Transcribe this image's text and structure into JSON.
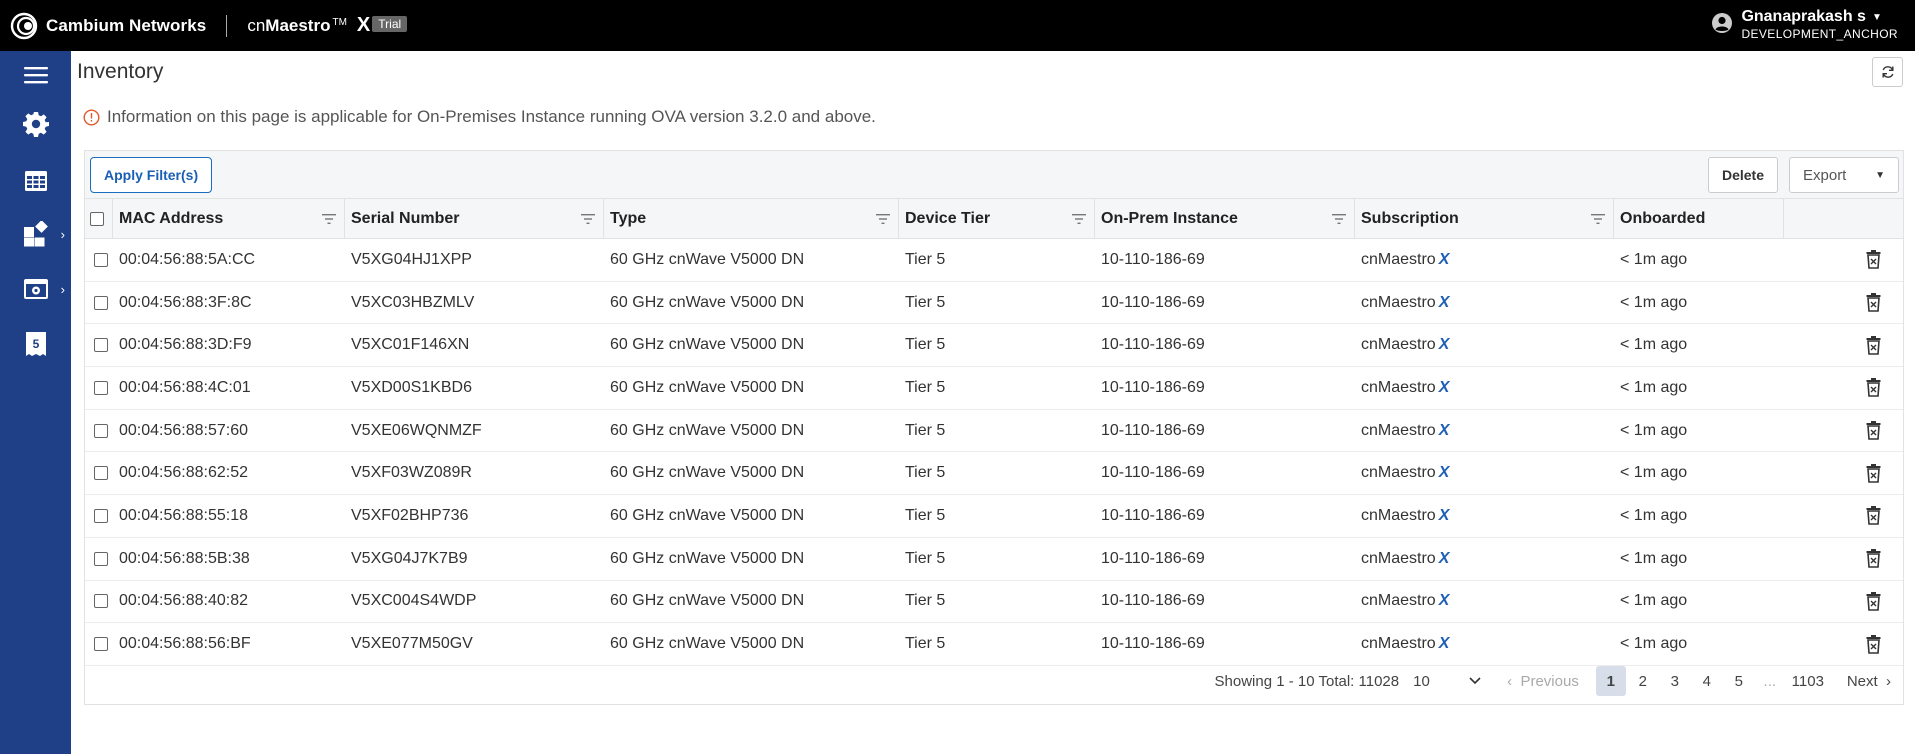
{
  "header": {
    "brand": "Cambium Networks",
    "product_prefix": "cn",
    "product_name": "Maestro",
    "product_tm": "TM",
    "product_x": "X",
    "trial_badge": "Trial",
    "user_name": "Gnanaprakash s",
    "user_org": "DEVELOPMENT_ANCHOR"
  },
  "sidebar": {
    "items": [
      {
        "icon": "menu-icon"
      },
      {
        "icon": "gear-icon"
      },
      {
        "icon": "table-icon"
      },
      {
        "icon": "dashboard-widgets-icon",
        "expandable": true
      },
      {
        "icon": "settings-window-icon",
        "expandable": true
      },
      {
        "icon": "license-tag-icon",
        "label": "5"
      }
    ]
  },
  "page": {
    "title": "Inventory",
    "info": "Information on this page is applicable for On-Premises Instance running OVA version 3.2.0 and above."
  },
  "toolbar": {
    "apply_filters": "Apply Filter(s)",
    "delete": "Delete",
    "export": "Export"
  },
  "table": {
    "columns": [
      "MAC Address",
      "Serial Number",
      "Type",
      "Device Tier",
      "On-Prem Instance",
      "Subscription",
      "Onboarded"
    ],
    "rows": [
      {
        "mac": "00:04:56:88:5A:CC",
        "serial": "V5XG04HJ1XPP",
        "type": "60 GHz cnWave V5000 DN",
        "tier": "Tier 5",
        "instance": "10-110-186-69",
        "subscription": "cnMaestro",
        "sub_suffix": "X",
        "onboarded": "< 1m ago"
      },
      {
        "mac": "00:04:56:88:3F:8C",
        "serial": "V5XC03HBZMLV",
        "type": "60 GHz cnWave V5000 DN",
        "tier": "Tier 5",
        "instance": "10-110-186-69",
        "subscription": "cnMaestro",
        "sub_suffix": "X",
        "onboarded": "< 1m ago"
      },
      {
        "mac": "00:04:56:88:3D:F9",
        "serial": "V5XC01F146XN",
        "type": "60 GHz cnWave V5000 DN",
        "tier": "Tier 5",
        "instance": "10-110-186-69",
        "subscription": "cnMaestro",
        "sub_suffix": "X",
        "onboarded": "< 1m ago"
      },
      {
        "mac": "00:04:56:88:4C:01",
        "serial": "V5XD00S1KBD6",
        "type": "60 GHz cnWave V5000 DN",
        "tier": "Tier 5",
        "instance": "10-110-186-69",
        "subscription": "cnMaestro",
        "sub_suffix": "X",
        "onboarded": "< 1m ago"
      },
      {
        "mac": "00:04:56:88:57:60",
        "serial": "V5XE06WQNMZF",
        "type": "60 GHz cnWave V5000 DN",
        "tier": "Tier 5",
        "instance": "10-110-186-69",
        "subscription": "cnMaestro",
        "sub_suffix": "X",
        "onboarded": "< 1m ago"
      },
      {
        "mac": "00:04:56:88:62:52",
        "serial": "V5XF03WZ089R",
        "type": "60 GHz cnWave V5000 DN",
        "tier": "Tier 5",
        "instance": "10-110-186-69",
        "subscription": "cnMaestro",
        "sub_suffix": "X",
        "onboarded": "< 1m ago"
      },
      {
        "mac": "00:04:56:88:55:18",
        "serial": "V5XF02BHP736",
        "type": "60 GHz cnWave V5000 DN",
        "tier": "Tier 5",
        "instance": "10-110-186-69",
        "subscription": "cnMaestro",
        "sub_suffix": "X",
        "onboarded": "< 1m ago"
      },
      {
        "mac": "00:04:56:88:5B:38",
        "serial": "V5XG04J7K7B9",
        "type": "60 GHz cnWave V5000 DN",
        "tier": "Tier 5",
        "instance": "10-110-186-69",
        "subscription": "cnMaestro",
        "sub_suffix": "X",
        "onboarded": "< 1m ago"
      },
      {
        "mac": "00:04:56:88:40:82",
        "serial": "V5XC004S4WDP",
        "type": "60 GHz cnWave V5000 DN",
        "tier": "Tier 5",
        "instance": "10-110-186-69",
        "subscription": "cnMaestro",
        "sub_suffix": "X",
        "onboarded": "< 1m ago"
      },
      {
        "mac": "00:04:56:88:56:BF",
        "serial": "V5XE077M50GV",
        "type": "60 GHz cnWave V5000 DN",
        "tier": "Tier 5",
        "instance": "10-110-186-69",
        "subscription": "cnMaestro",
        "sub_suffix": "X",
        "onboarded": "< 1m ago"
      }
    ]
  },
  "pagination": {
    "showing": "Showing 1 - 10 Total: 11028",
    "page_size": "10",
    "previous": "Previous",
    "pages": [
      "1",
      "2",
      "3",
      "4",
      "5"
    ],
    "ellipsis": "...",
    "last_page": "1103",
    "next": "Next",
    "current": "1"
  },
  "colors": {
    "sidebar_bg": "#1f3f86",
    "topbar_bg": "#000000",
    "accent": "#1a6ec0",
    "info_icon": "#e05a2b"
  }
}
